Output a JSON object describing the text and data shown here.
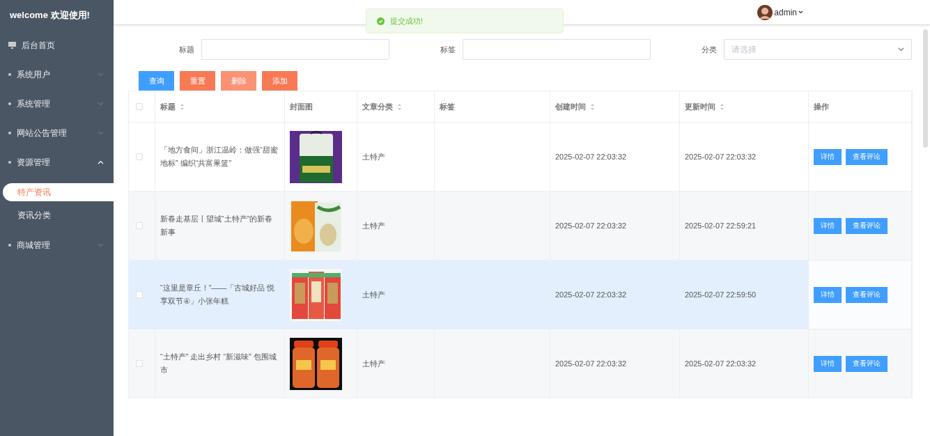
{
  "sidebar": {
    "welcome": "welcome 欢迎使用!",
    "items": [
      {
        "label": "后台首页",
        "kind": "home"
      },
      {
        "label": "系统用户",
        "kind": "group",
        "expanded": false
      },
      {
        "label": "系统管理",
        "kind": "group",
        "expanded": false
      },
      {
        "label": "网站公告管理",
        "kind": "group",
        "expanded": false
      },
      {
        "label": "资源管理",
        "kind": "group",
        "expanded": true,
        "children": [
          {
            "label": "特产资讯",
            "selected": true
          },
          {
            "label": "资讯分类",
            "selected": false
          }
        ]
      },
      {
        "label": "商城管理",
        "kind": "group",
        "expanded": false
      }
    ]
  },
  "header": {
    "user": "admin"
  },
  "toast": {
    "message": "提交成功!"
  },
  "filters": [
    {
      "label": "标题",
      "kind": "text"
    },
    {
      "label": "标签",
      "kind": "text"
    },
    {
      "label": "分类",
      "kind": "select",
      "placeholder": "请选择"
    }
  ],
  "actions": [
    {
      "label": "查询",
      "kind": "primary"
    },
    {
      "label": "重置",
      "kind": "warning"
    },
    {
      "label": "删除",
      "kind": "danger-light"
    },
    {
      "label": "添加",
      "kind": "warning"
    }
  ],
  "table": {
    "all_checked": false,
    "columns": [
      {
        "label": "标题",
        "sortable": true
      },
      {
        "label": "封面图",
        "sortable": false
      },
      {
        "label": "文章分类",
        "sortable": true
      },
      {
        "label": "标签",
        "sortable": false
      },
      {
        "label": "创建时间",
        "sortable": true
      },
      {
        "label": "更新时间",
        "sortable": true
      },
      {
        "label": "操作",
        "sortable": false
      }
    ],
    "rows": [
      {
        "checked": false,
        "hovered": false,
        "title": "「地方食间」浙江温岭：做强“甜蜜地标” 编织“共富果篮”",
        "cover": {
          "kind": "picture"
        },
        "category": "土特产",
        "created": "2025-02-07 22:03:32",
        "updated": "2025-02-07 22:03:32",
        "buttons": [
          "详情",
          "查看评论"
        ]
      },
      {
        "checked": false,
        "hovered": false,
        "title": "新春走基层丨望城“土特产”的新春新事",
        "cover": {
          "kind": "picture"
        },
        "category": "土特产",
        "created": "2025-02-07 22:03:32",
        "updated": "2025-02-07 22:59:21",
        "buttons": [
          "详情",
          "查看评论"
        ]
      },
      {
        "checked": false,
        "hovered": true,
        "title": "“这里是章丘！”——「古城好品 悦享双节④」小张年糕",
        "cover": {
          "kind": "picture"
        },
        "category": "土特产",
        "created": "2025-02-07 22:03:32",
        "updated": "2025-02-07 22:59:50",
        "buttons": [
          "详情",
          "查看评论"
        ]
      },
      {
        "checked": false,
        "hovered": false,
        "title": "“土特产” 走出乡村 “新滋味” 包围城市",
        "cover": {
          "kind": "picture"
        },
        "category": "土特产",
        "created": "2025-02-07 22:03:32",
        "updated": "2025-02-07 22:03:32",
        "buttons": [
          "详情",
          "查看评论"
        ]
      }
    ]
  }
}
